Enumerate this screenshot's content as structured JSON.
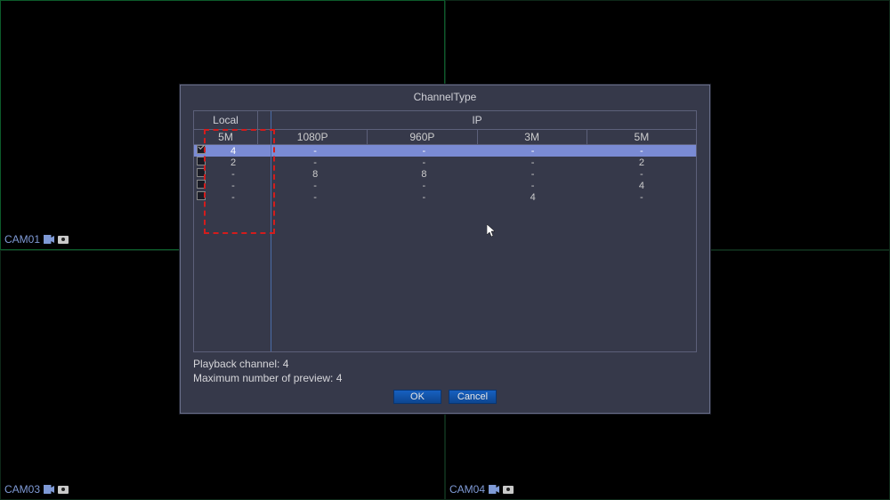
{
  "cams": {
    "tl": "CAM01",
    "tr": "",
    "bl": "CAM03",
    "br": "CAM04"
  },
  "dialog": {
    "title": "ChannelType",
    "local_label": "Local",
    "ip_label": "IP",
    "local_col": "5M",
    "ip_cols": [
      "1080P",
      "960P",
      "3M",
      "5M"
    ],
    "rows": [
      {
        "checked": true,
        "selected": true,
        "local": "4",
        "ip": [
          "-",
          "-",
          "-",
          "-"
        ]
      },
      {
        "checked": false,
        "selected": false,
        "local": "2",
        "ip": [
          "-",
          "-",
          "-",
          "2"
        ]
      },
      {
        "checked": false,
        "selected": false,
        "local": "-",
        "ip": [
          "8",
          "8",
          "-",
          "-"
        ]
      },
      {
        "checked": false,
        "selected": false,
        "local": "-",
        "ip": [
          "-",
          "-",
          "-",
          "4"
        ]
      },
      {
        "checked": false,
        "selected": false,
        "local": "-",
        "ip": [
          "-",
          "-",
          "4",
          "-"
        ]
      }
    ],
    "playback": "Playback channel: 4",
    "max_preview": "Maximum number of preview: 4",
    "ok": "OK",
    "cancel": "Cancel"
  }
}
